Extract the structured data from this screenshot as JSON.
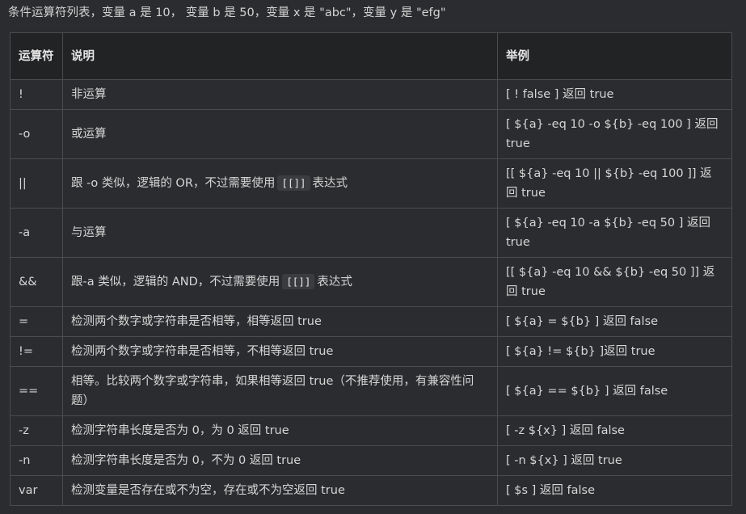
{
  "intro": "条件运算符列表，变量 a 是 10， 变量 b 是 50，变量 x 是 \"abc\"，变量 y 是 \"efg\"",
  "table": {
    "headers": {
      "operator": "运算符",
      "description": "说明",
      "example": "举例"
    },
    "rows": [
      {
        "op": "!",
        "desc": "非运算",
        "ex": "[ ! false ] 返回 true"
      },
      {
        "op": "-o",
        "desc": "或运算",
        "ex": "[ ${a} -eq 10 -o ${b} -eq 100 ] 返回 true"
      },
      {
        "op": "||",
        "desc_pre": "跟 -o 类似，逻辑的 OR，不过需要使用",
        "desc_code": "[[]]",
        "desc_post": "表达式",
        "ex": "[[ ${a} -eq 10 || ${b} -eq 100 ]] 返回 true"
      },
      {
        "op": "-a",
        "desc": "与运算",
        "ex": "[ ${a} -eq 10 -a ${b} -eq 50 ] 返回 true"
      },
      {
        "op": "&&",
        "desc_pre": "跟-a 类似，逻辑的 AND，不过需要使用",
        "desc_code": "[[]]",
        "desc_post": "表达式",
        "ex": "[[ ${a} -eq 10 && ${b} -eq 50 ]] 返回 true"
      },
      {
        "op": "=",
        "desc": "检测两个数字或字符串是否相等，相等返回 true",
        "ex": "[ ${a} = ${b} ] 返回 false"
      },
      {
        "op": "!=",
        "desc": "检测两个数字或字符串是否相等，不相等返回 true",
        "ex": "[ ${a} != ${b} ]返回 true"
      },
      {
        "op": "==",
        "desc": "相等。比较两个数字或字符串，如果相等返回 true（不推荐使用，有兼容性问题）",
        "ex": "[ ${a} == ${b} ] 返回 false"
      },
      {
        "op": "-z",
        "desc": "检测字符串长度是否为 0，为 0 返回 true",
        "ex": "[ -z ${x} ] 返回 false"
      },
      {
        "op": "-n",
        "desc": "检测字符串长度是否为 0，不为 0 返回 true",
        "ex": "[ -n ${x} ] 返回 true"
      },
      {
        "op": "var",
        "desc": "检测变量是否存在或不为空，存在或不为空返回 true",
        "ex": "[ $s ] 返回 false"
      }
    ]
  }
}
